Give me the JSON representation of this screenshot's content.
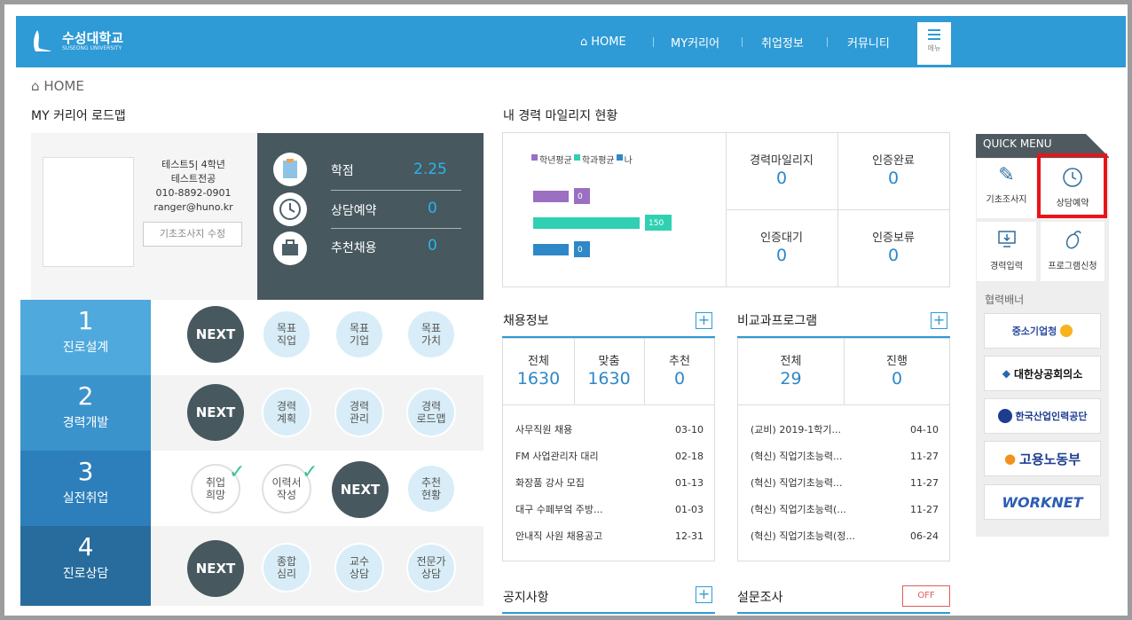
{
  "header": {
    "logo_ko": "수성대학교",
    "logo_en": "SUSEONG UNIVERSITY",
    "nav": [
      "HOME",
      "MY커리어",
      "취업정보",
      "커뮤니티"
    ],
    "menu_label": "메뉴"
  },
  "breadcrumb": "HOME",
  "roadmap": {
    "title": "MY 커리어 로드맵",
    "profile": {
      "line1": "테스트5| 4학년",
      "line2": "테스트전공",
      "phone": "010-8892-0901",
      "email": "ranger@huno.kr",
      "edit_button": "기초조사지 수정"
    },
    "stats": [
      {
        "label": "학점",
        "value": "2.25"
      },
      {
        "label": "상담예약",
        "value": "0"
      },
      {
        "label": "추천채용",
        "value": "0"
      }
    ],
    "stages": [
      {
        "num": "1",
        "label": "진로설계",
        "items": [
          "NEXT",
          "목표\n직업",
          "목표\n기업",
          "목표\n가치"
        ]
      },
      {
        "num": "2",
        "label": "경력개발",
        "items": [
          "NEXT",
          "경력\n계획",
          "경력\n관리",
          "경력\n로드맵"
        ]
      },
      {
        "num": "3",
        "label": "실전취업",
        "items": [
          "취업\n희망",
          "이력서\n작성",
          "NEXT",
          "추천\n현황"
        ]
      },
      {
        "num": "4",
        "label": "진로상담",
        "items": [
          "NEXT",
          "종합\n심리",
          "교수\n상담",
          "전문가\n상담"
        ]
      }
    ]
  },
  "mileage": {
    "title": "내 경력 마일리지 현황",
    "legend": [
      "학년평균",
      "학과평균",
      "나"
    ],
    "chart_data": {
      "type": "bar",
      "categories": [
        "학년평균",
        "학과평균",
        "나"
      ],
      "values": [
        0,
        150,
        0
      ],
      "colors": [
        "#9b6fc1",
        "#2fd1b2",
        "#2e88c8"
      ]
    },
    "cells": [
      {
        "label": "경력마일리지",
        "value": "0"
      },
      {
        "label": "인증완료",
        "value": "0"
      },
      {
        "label": "인증대기",
        "value": "0"
      },
      {
        "label": "인증보류",
        "value": "0"
      }
    ]
  },
  "jobs": {
    "title": "채용정보",
    "cols": [
      {
        "label": "전체",
        "value": "1630"
      },
      {
        "label": "맞춤",
        "value": "1630"
      },
      {
        "label": "추천",
        "value": "0"
      }
    ],
    "items": [
      {
        "t": "사무직원 채용",
        "d": "03-10"
      },
      {
        "t": "FM 사업관리자 대리",
        "d": "02-18"
      },
      {
        "t": "화장품 강사 모집",
        "d": "01-13"
      },
      {
        "t": "대구 수페부엌 주방...",
        "d": "01-03"
      },
      {
        "t": "안내직 사원 채용공고",
        "d": "12-31"
      }
    ]
  },
  "programs": {
    "title": "비교과프로그램",
    "cols": [
      {
        "label": "전체",
        "value": "29"
      },
      {
        "label": "진행",
        "value": "0"
      }
    ],
    "items": [
      {
        "t": "(교비) 2019-1학기...",
        "d": "04-10"
      },
      {
        "t": "(혁신) 직업기초능력...",
        "d": "11-27"
      },
      {
        "t": "(혁신) 직업기초능력...",
        "d": "11-27"
      },
      {
        "t": "(혁신) 직업기초능력(...",
        "d": "11-27"
      },
      {
        "t": "(혁신) 직업기초능력(정...",
        "d": "06-24"
      }
    ]
  },
  "notice": {
    "title": "공지사항"
  },
  "survey": {
    "title": "설문조사",
    "badge": "OFF"
  },
  "quick": {
    "title": "QUICK MENU",
    "items": [
      "기초조사지",
      "상담예약",
      "경력입력",
      "프로그램신청"
    ],
    "banner_title": "협력배너",
    "banners": [
      "중소기업청",
      "대한상공회의소",
      "한국산업인력공단",
      "고용노동부",
      "WORKNET"
    ]
  }
}
